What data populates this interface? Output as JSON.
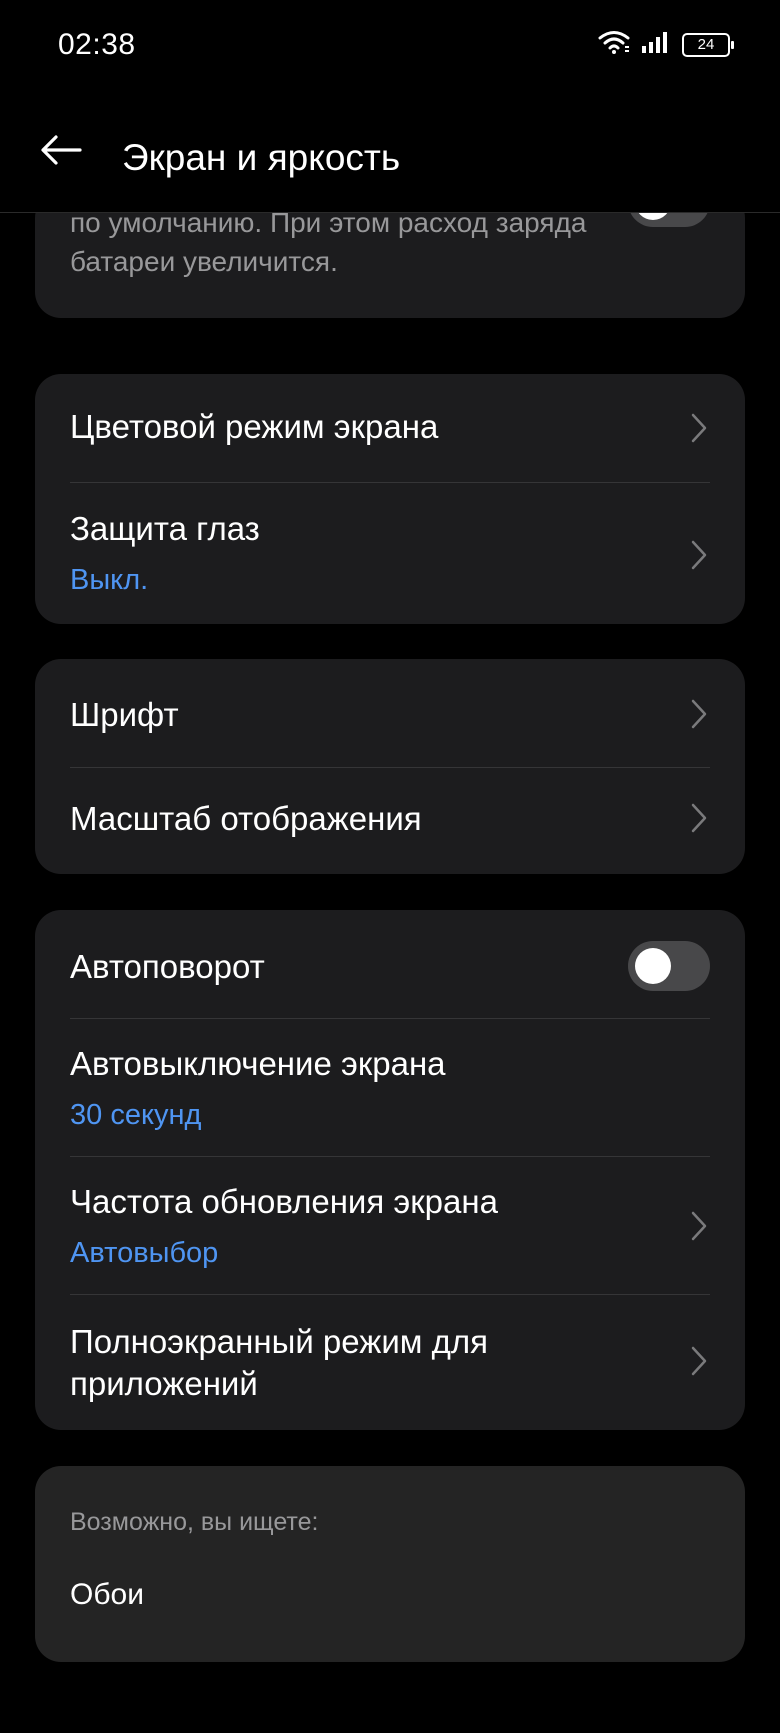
{
  "status_bar": {
    "time": "02:38",
    "battery": "24",
    "icons": [
      "wifi-icon",
      "signal-icon",
      "battery-icon"
    ]
  },
  "app_bar": {
    "title": "Экран и яркость",
    "back_icon": "arrow-left-icon"
  },
  "brightness_card": {
    "description": "яркость экрана за пределами диапазона по умолчанию. При этом расход заряда батареи увеличится.",
    "toggle_on": false
  },
  "color_card": {
    "items": [
      {
        "title": "Цветовой режим экрана"
      },
      {
        "title": "Защита глаз",
        "value": "Выкл."
      }
    ]
  },
  "font_card": {
    "items": [
      {
        "title": "Шрифт"
      },
      {
        "title": "Масштаб отображения"
      }
    ]
  },
  "screen_card": {
    "autorotate": {
      "title": "Автоповорот",
      "toggle_on": false
    },
    "timeout": {
      "title": "Автовыключение экрана",
      "value": "30 секунд"
    },
    "refresh": {
      "title": "Частота обновления экрана",
      "value": "Автовыбор"
    },
    "fullscreen": {
      "title": "Полноэкранный режим для приложений"
    }
  },
  "suggestions": {
    "heading": "Возможно, вы ищете:",
    "items": [
      "Обои"
    ]
  },
  "colors": {
    "background": "#000000",
    "card": "#1c1c1e",
    "accent": "#4f95f2",
    "secondary_text": "#98989a"
  }
}
